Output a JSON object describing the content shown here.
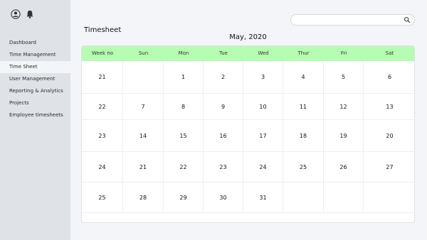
{
  "sidebar": {
    "icons": [
      "user-icon",
      "bell-icon"
    ],
    "items": [
      {
        "label": "Dashboard",
        "active": false
      },
      {
        "label": "Time Management",
        "active": false
      },
      {
        "label": "Time Sheet",
        "active": true
      },
      {
        "label": "User Management",
        "active": false
      },
      {
        "label": "Reporting & Analytics",
        "active": false
      },
      {
        "label": "Projects",
        "active": false
      },
      {
        "label": "Employee timesheets",
        "active": false
      }
    ]
  },
  "search": {
    "value": "",
    "placeholder": ""
  },
  "page": {
    "title": "Timesheet",
    "month": "May, 2020"
  },
  "calendar": {
    "headers": [
      "Week no",
      "Sun",
      "Mon",
      "Tue",
      "Wed",
      "Thur",
      "Fri",
      "Sat"
    ],
    "rows": [
      [
        "21",
        "",
        "1",
        "2",
        "3",
        "4",
        "5",
        "6"
      ],
      [
        "22",
        "7",
        "8",
        "9",
        "10",
        "11",
        "12",
        "13"
      ],
      [
        "23",
        "14",
        "15",
        "16",
        "17",
        "18",
        "19",
        "20"
      ],
      [
        "24",
        "21",
        "22",
        "23",
        "24",
        "25",
        "26",
        "27"
      ],
      [
        "25",
        "28",
        "29",
        "30",
        "31",
        "",
        "",
        ""
      ]
    ],
    "header_color": "#b6fcb2"
  }
}
